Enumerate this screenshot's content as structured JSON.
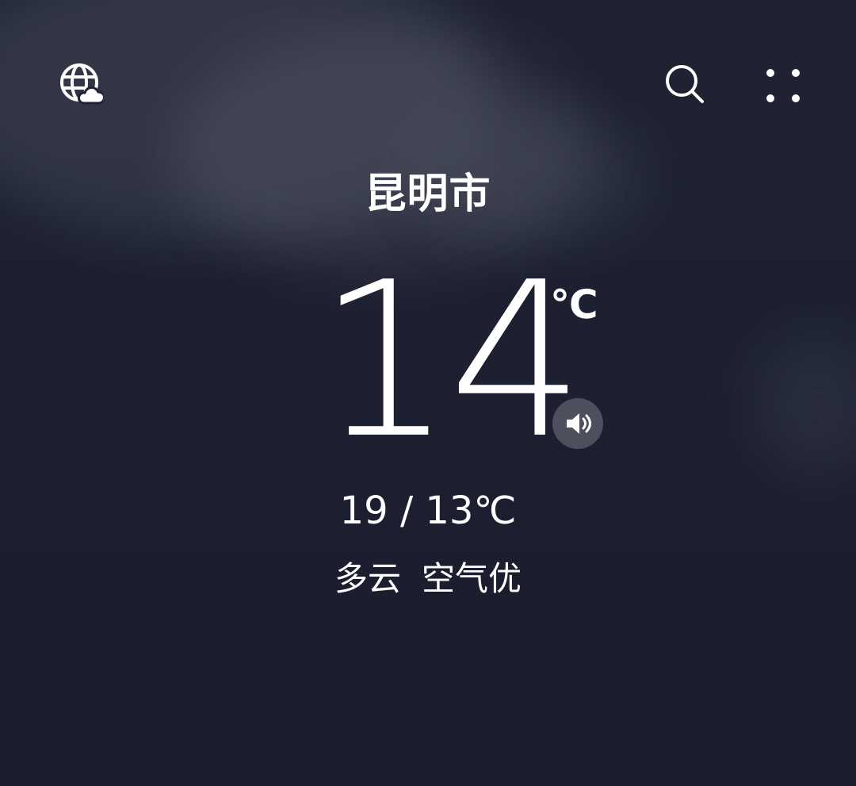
{
  "header": {
    "icons": [
      "globe-cloud-icon",
      "search-icon",
      "more-dots-icon"
    ]
  },
  "weather": {
    "city": "昆明市",
    "current_temp": "14",
    "unit": "℃",
    "range": "19 / 13℃",
    "condition": "多云",
    "air_quality": "空气优"
  },
  "colors": {
    "background": "#1d2030",
    "text": "#ffffff",
    "speaker_bg": "rgba(255,255,255,0.22)"
  }
}
